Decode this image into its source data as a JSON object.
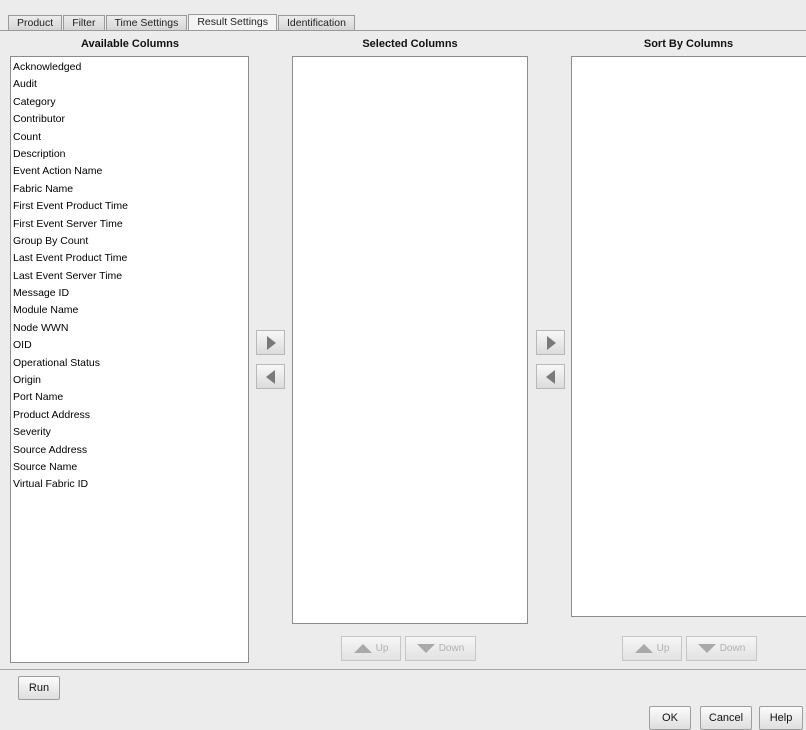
{
  "tabs": [
    {
      "label": "Product",
      "active": false
    },
    {
      "label": "Filter",
      "active": false
    },
    {
      "label": "Time Settings",
      "active": false
    },
    {
      "label": "Result Settings",
      "active": true
    },
    {
      "label": "Identification",
      "active": false
    }
  ],
  "columns": {
    "available_title": "Available Columns",
    "selected_title": "Selected Columns",
    "sort_title": "Sort By Columns"
  },
  "available_items": [
    "Acknowledged",
    "Audit",
    "Category",
    "Contributor",
    "Count",
    "Description",
    "Event Action Name",
    "Fabric Name",
    "First Event Product Time",
    "First Event Server Time",
    "Group By Count",
    "Last Event Product Time",
    "Last Event Server Time",
    "Message ID",
    "Module Name",
    "Node WWN",
    "OID",
    "Operational Status",
    "Origin",
    "Port Name",
    "Product Address",
    "Severity",
    "Source Address",
    "Source Name",
    "Virtual Fabric ID"
  ],
  "selected_items": [],
  "sort_items": [],
  "buttons": {
    "up": "Up",
    "down": "Down",
    "run": "Run",
    "ok": "OK",
    "cancel": "Cancel",
    "help": "Help"
  },
  "icons": {
    "add": "arrow-right-icon",
    "remove": "arrow-left-icon",
    "up": "triangle-up-icon",
    "down": "triangle-down-icon"
  },
  "colors": {
    "background": "#ececec",
    "arrow": "#7a7a7a",
    "disabled_arrow": "#a9a9a9"
  }
}
